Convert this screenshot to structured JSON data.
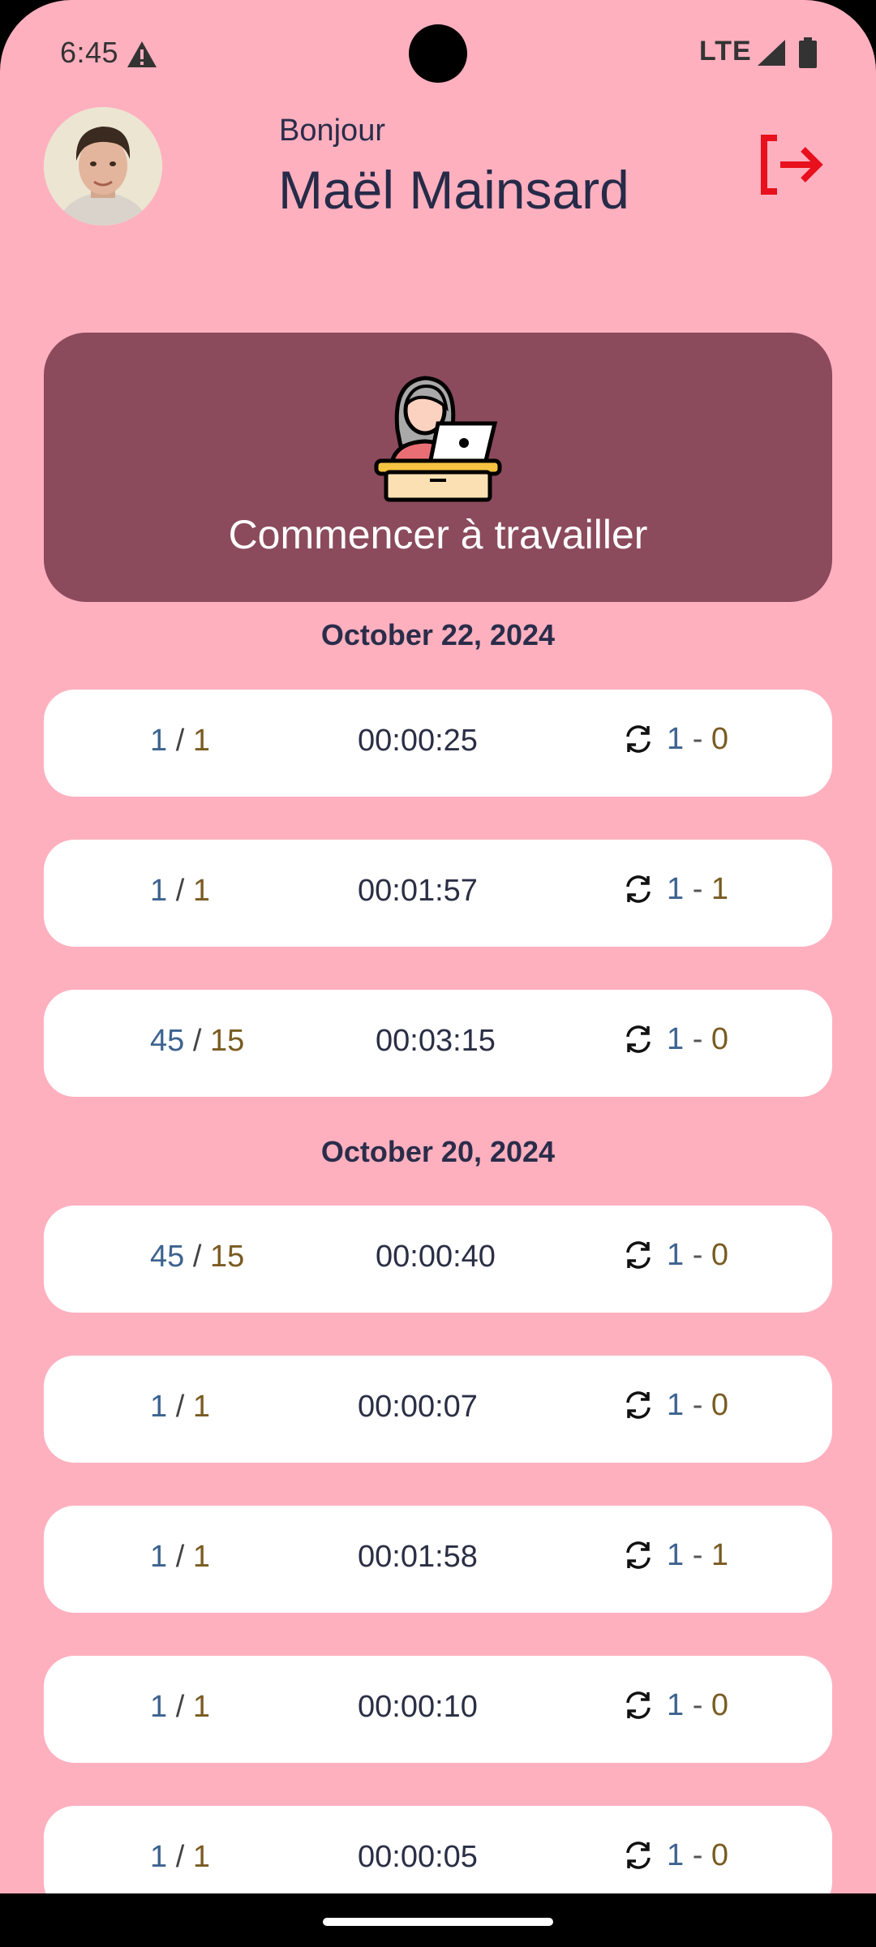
{
  "status_bar": {
    "time": "6:45",
    "network": "LTE",
    "icons": [
      "alert-icon",
      "signal-icon",
      "battery-icon"
    ]
  },
  "header": {
    "greeting": "Bonjour",
    "user_name": "Maël Mainsard",
    "logout_icon": "logout-icon"
  },
  "start_work": {
    "label": "Commencer à travailler",
    "icon": "worker-at-laptop-icon"
  },
  "days": [
    {
      "date": "October 22, 2024",
      "sessions": [
        {
          "ratio_a": "1",
          "ratio_b": "1",
          "duration": "00:00:25",
          "cycle_a": "1",
          "cycle_b": "0"
        },
        {
          "ratio_a": "1",
          "ratio_b": "1",
          "duration": "00:01:57",
          "cycle_a": "1",
          "cycle_b": "1"
        },
        {
          "ratio_a": "45",
          "ratio_b": "15",
          "duration": "00:03:15",
          "cycle_a": "1",
          "cycle_b": "0"
        }
      ]
    },
    {
      "date": "October 20, 2024",
      "sessions": [
        {
          "ratio_a": "45",
          "ratio_b": "15",
          "duration": "00:00:40",
          "cycle_a": "1",
          "cycle_b": "0"
        },
        {
          "ratio_a": "1",
          "ratio_b": "1",
          "duration": "00:00:07",
          "cycle_a": "1",
          "cycle_b": "0"
        },
        {
          "ratio_a": "1",
          "ratio_b": "1",
          "duration": "00:01:58",
          "cycle_a": "1",
          "cycle_b": "1"
        },
        {
          "ratio_a": "1",
          "ratio_b": "1",
          "duration": "00:00:10",
          "cycle_a": "1",
          "cycle_b": "0"
        },
        {
          "ratio_a": "1",
          "ratio_b": "1",
          "duration": "00:00:05",
          "cycle_a": "1",
          "cycle_b": "0"
        }
      ]
    }
  ],
  "colors": {
    "background": "#ffb0bf",
    "card_primary": "#8b4b5c",
    "text_dark": "#262b48",
    "accent_blue": "#3d6390",
    "accent_brown": "#7a5b22",
    "logout_red": "#e8101c"
  }
}
